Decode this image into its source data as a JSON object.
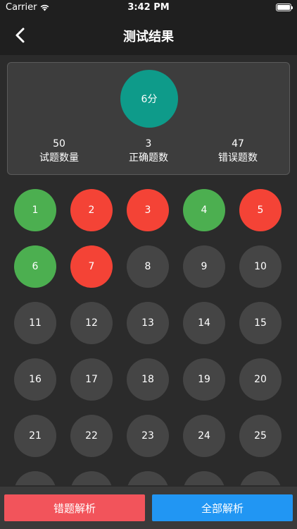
{
  "status_bar": {
    "carrier": "Carrier",
    "time": "3:42 PM",
    "wifi_icon": "wifi-icon",
    "battery_icon": "battery-icon"
  },
  "nav": {
    "title": "测试结果",
    "back_icon": "chevron-left-icon"
  },
  "summary": {
    "score": "6分",
    "score_color": "#0e9b8a",
    "stats": [
      {
        "value": "50",
        "label": "试题数量"
      },
      {
        "value": "3",
        "label": "正确题数"
      },
      {
        "value": "47",
        "label": "错误题数"
      }
    ]
  },
  "colors": {
    "correct": "#4caf50",
    "wrong": "#f44336",
    "unanswered": "#454545",
    "wrong_button": "#f2545b",
    "all_button": "#2196f3"
  },
  "questions": [
    {
      "n": "1",
      "status": "correct"
    },
    {
      "n": "2",
      "status": "wrong"
    },
    {
      "n": "3",
      "status": "wrong"
    },
    {
      "n": "4",
      "status": "correct"
    },
    {
      "n": "5",
      "status": "wrong"
    },
    {
      "n": "6",
      "status": "correct"
    },
    {
      "n": "7",
      "status": "wrong"
    },
    {
      "n": "8",
      "status": "unanswered"
    },
    {
      "n": "9",
      "status": "unanswered"
    },
    {
      "n": "10",
      "status": "unanswered"
    },
    {
      "n": "11",
      "status": "unanswered"
    },
    {
      "n": "12",
      "status": "unanswered"
    },
    {
      "n": "13",
      "status": "unanswered"
    },
    {
      "n": "14",
      "status": "unanswered"
    },
    {
      "n": "15",
      "status": "unanswered"
    },
    {
      "n": "16",
      "status": "unanswered"
    },
    {
      "n": "17",
      "status": "unanswered"
    },
    {
      "n": "18",
      "status": "unanswered"
    },
    {
      "n": "19",
      "status": "unanswered"
    },
    {
      "n": "20",
      "status": "unanswered"
    },
    {
      "n": "21",
      "status": "unanswered"
    },
    {
      "n": "22",
      "status": "unanswered"
    },
    {
      "n": "23",
      "status": "unanswered"
    },
    {
      "n": "24",
      "status": "unanswered"
    },
    {
      "n": "25",
      "status": "unanswered"
    },
    {
      "n": "",
      "status": "unanswered"
    },
    {
      "n": "",
      "status": "unanswered"
    },
    {
      "n": "",
      "status": "unanswered"
    },
    {
      "n": "",
      "status": "unanswered"
    },
    {
      "n": "",
      "status": "unanswered"
    }
  ],
  "bottom": {
    "wrong_analysis": "错题解析",
    "all_analysis": "全部解析"
  }
}
